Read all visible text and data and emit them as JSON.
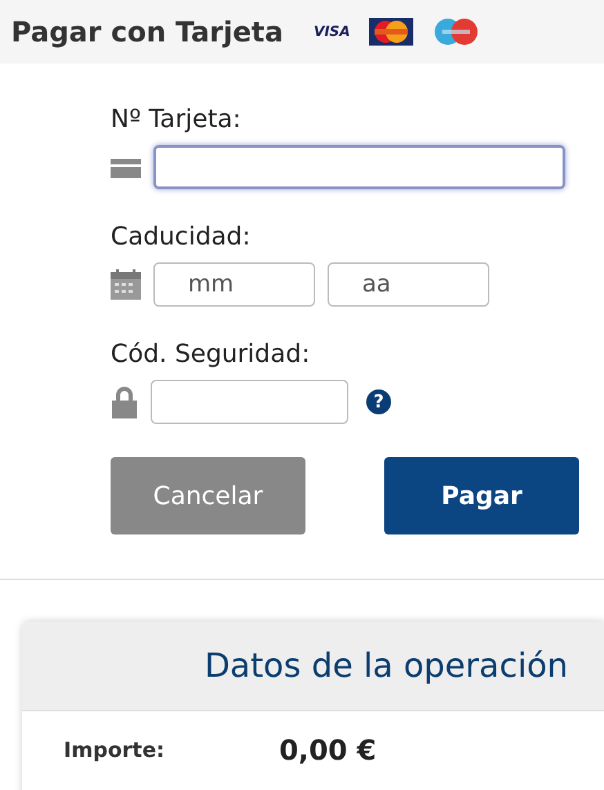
{
  "header": {
    "title": "Pagar con Tarjeta",
    "brands": [
      {
        "kind": "visa",
        "label": "VISA"
      },
      {
        "kind": "mastercard"
      },
      {
        "kind": "maestro"
      }
    ]
  },
  "form": {
    "card_number": {
      "label": "Nº Tarjeta:",
      "focused": true
    },
    "expiry": {
      "label": "Caducidad:",
      "month_placeholder": "mm",
      "year_placeholder": "aa"
    },
    "security_code": {
      "label": "Cód. Seguridad:",
      "help": "?"
    }
  },
  "buttons": [
    {
      "kind": "secondary",
      "label": "Cancelar"
    },
    {
      "kind": "primary",
      "label": "Pagar"
    }
  ],
  "operation": {
    "title": "Datos de la operación",
    "rows": [
      {
        "label": "Importe:",
        "value": "0,00 €"
      }
    ]
  }
}
